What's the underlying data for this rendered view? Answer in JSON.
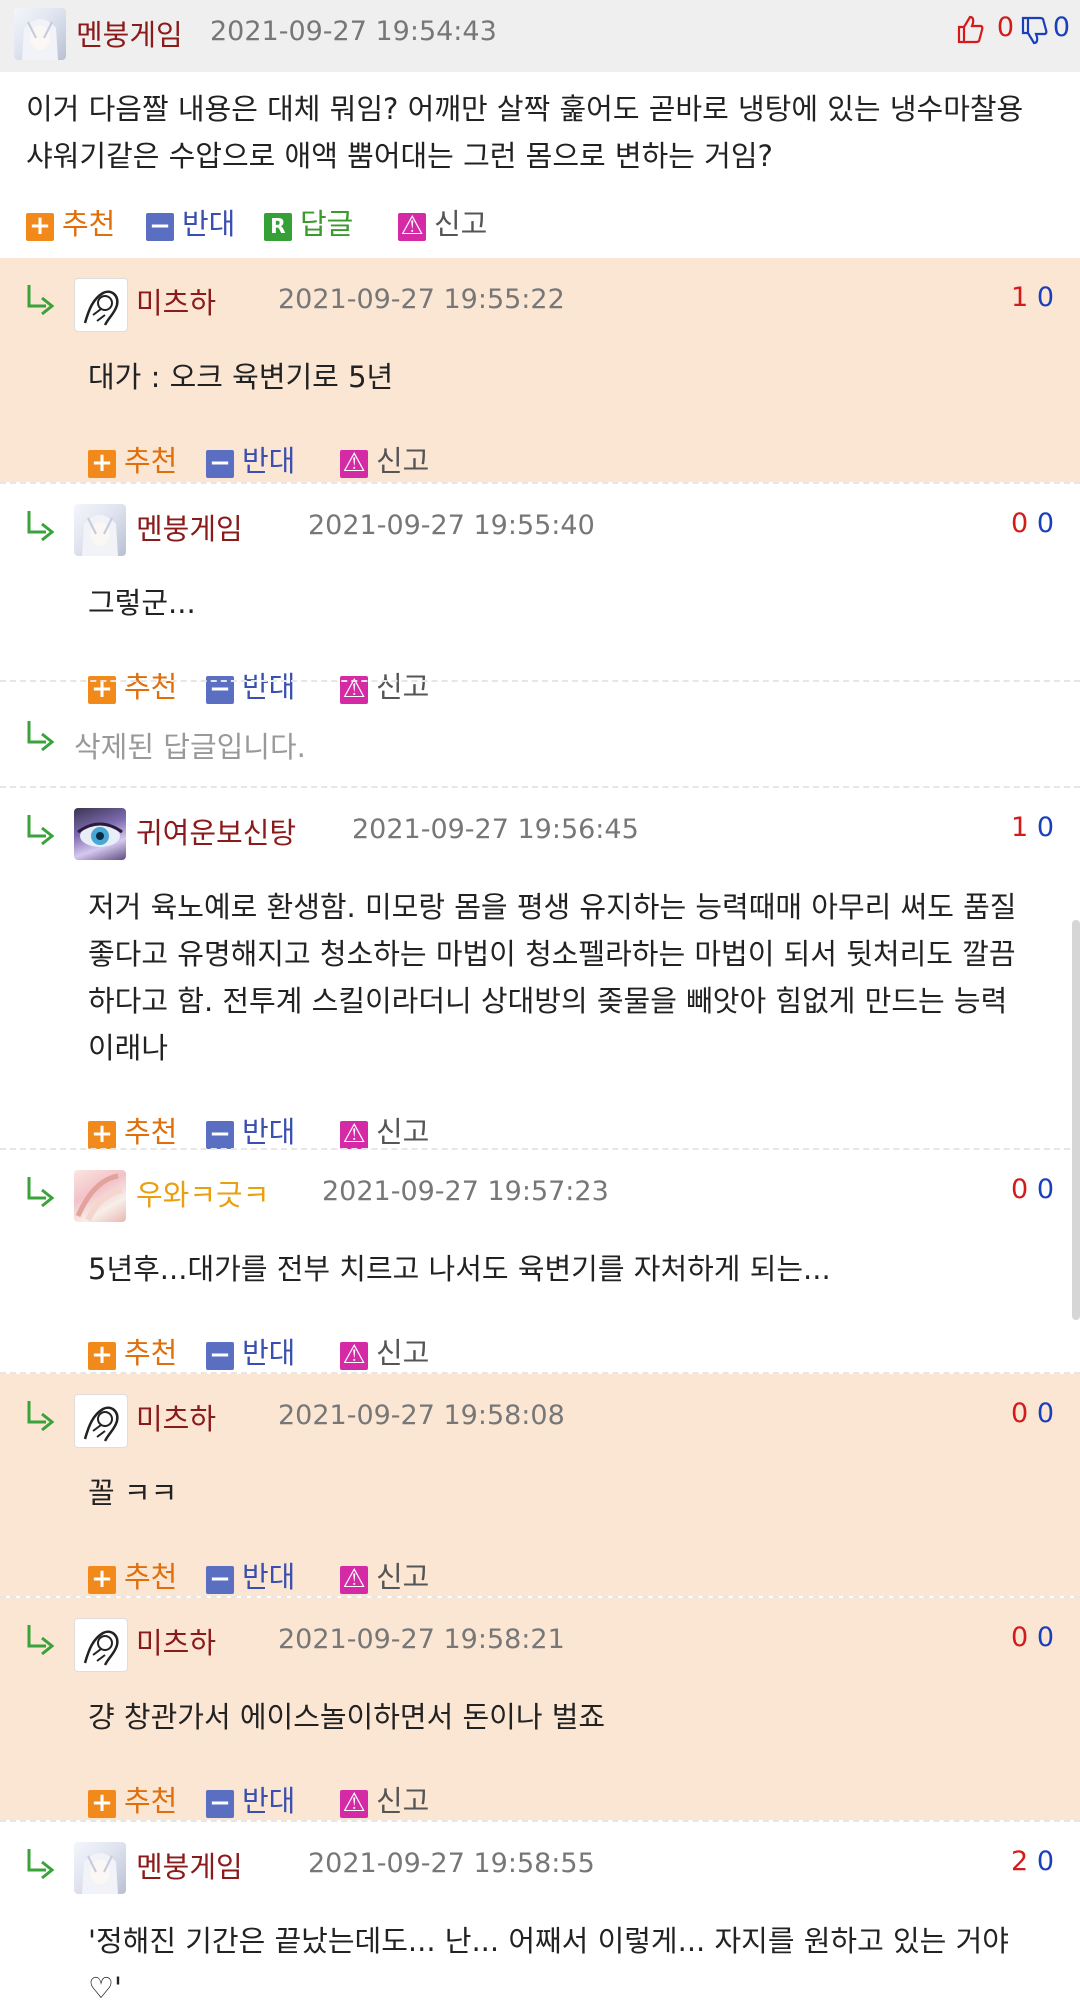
{
  "post": {
    "nick": "멘붕게임",
    "nick_color": "#8b1a1a",
    "date": "2021-09-27 19:54:43",
    "up": "0",
    "down": "0",
    "body_lines": [
      "이거 다음짤 내용은 대체 뭐임? 어깨만 살짝 훑어도 곧바로 냉탕에 있는 냉수마찰용",
      "샤워기같은 수압으로 애액 뿜어대는 그런 몸으로 변하는 거임?"
    ],
    "actions": {
      "recommend": "추천",
      "oppose": "반대",
      "reply": "답글",
      "report": "신고"
    }
  },
  "comments": [
    {
      "nick": "미츠하",
      "nick_color": "#8b1a1a",
      "date": "2021-09-27 19:55:22",
      "up": "1",
      "down": "0",
      "lines": [
        "대가 : 오크 육변기로 5년"
      ],
      "highlight": true,
      "avatar": "sketch-avatar"
    },
    {
      "nick": "멘붕게임",
      "nick_color": "#8b1a1a",
      "date": "2021-09-27 19:55:40",
      "up": "0",
      "down": "0",
      "lines": [
        "그렇군..."
      ],
      "highlight": false,
      "avatar": "white-hair-avatar"
    },
    {
      "deleted_text": "삭제된 답글입니다."
    },
    {
      "nick": "귀여운보신탕",
      "nick_color": "#8b1a1a",
      "date": "2021-09-27 19:56:45",
      "up": "1",
      "down": "0",
      "lines": [
        "저거 육노예로 환생함. 미모랑 몸을 평생 유지하는 능력때매 아무리 써도 품질",
        "좋다고 유명해지고 청소하는 마법이 청소펠라하는 마법이 되서 뒷처리도 깔끔",
        "하다고 함. 전투계 스킬이라더니 상대방의 좆물을 빼앗아 힘없게 만드는 능력",
        "이래나"
      ],
      "highlight": false,
      "avatar": "eye-avatar"
    },
    {
      "nick": "우와ㅋ긋ㅋ",
      "nick_color": "#e8a010",
      "date": "2021-09-27 19:57:23",
      "up": "0",
      "down": "0",
      "lines": [
        "5년후...대가를 전부 치르고 나서도 육변기를 자처하게 되는..."
      ],
      "highlight": false,
      "avatar": "pink-avatar"
    },
    {
      "nick": "미츠하",
      "nick_color": "#8b1a1a",
      "date": "2021-09-27 19:58:08",
      "up": "0",
      "down": "0",
      "lines": [
        "꼴 ㅋㅋ"
      ],
      "highlight": true,
      "avatar": "sketch-avatar"
    },
    {
      "nick": "미츠하",
      "nick_color": "#8b1a1a",
      "date": "2021-09-27 19:58:21",
      "up": "0",
      "down": "0",
      "lines": [
        "걍 창관가서 에이스놀이하면서 돈이나 벌죠"
      ],
      "highlight": true,
      "avatar": "sketch-avatar"
    },
    {
      "nick": "멘붕게임",
      "nick_color": "#8b1a1a",
      "date": "2021-09-27 19:58:55",
      "up": "2",
      "down": "0",
      "lines": [
        "'정해진 기간은 끝났는데도... 난... 어째서 이렇게... 자지를 원하고 있는 거야",
        "♡'"
      ],
      "highlight": false,
      "avatar": "white-hair-avatar"
    }
  ],
  "comment_actions": {
    "recommend": "추천",
    "oppose": "반대",
    "report": "신고"
  },
  "colors": {
    "highlight_bg": "#fbe6d4",
    "up": "#d51a1a",
    "down": "#1a3fbd",
    "reply_arrow": "#3aa23a"
  }
}
